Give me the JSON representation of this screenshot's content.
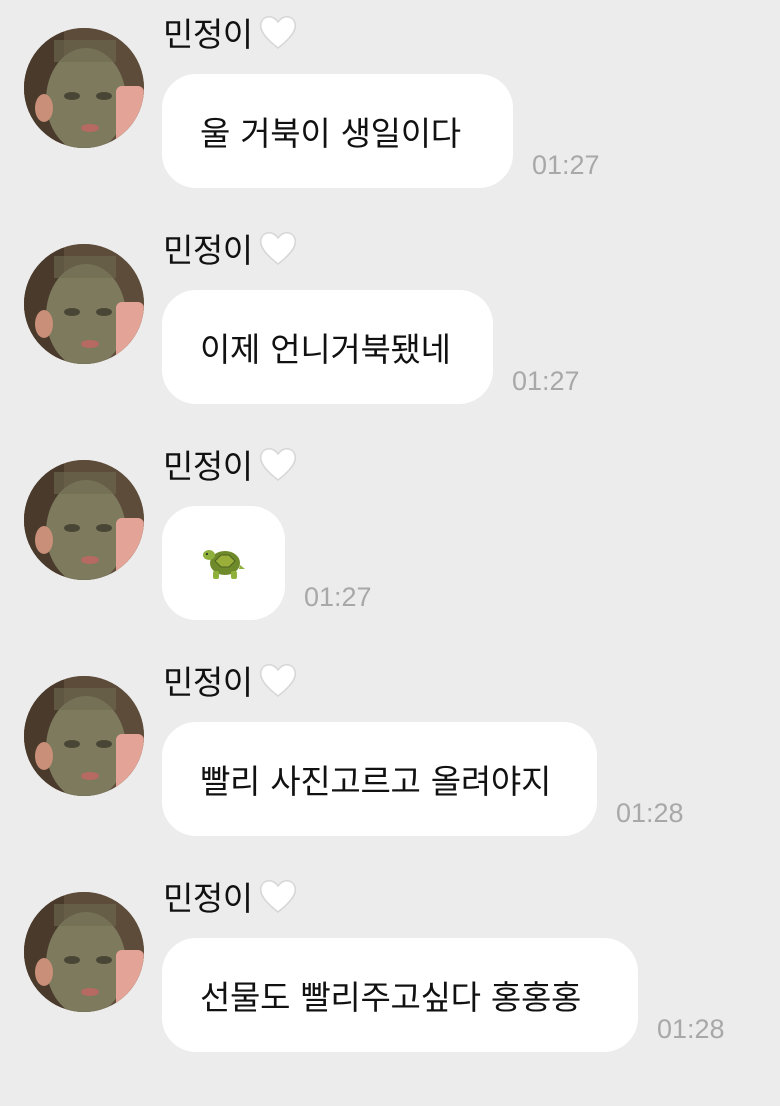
{
  "colors": {
    "background": "#ececec",
    "bubble": "#ffffff",
    "text": "#111111",
    "timestamp": "#a8a8a8"
  },
  "messages": [
    {
      "sender": "민정이",
      "sender_badge": "white-heart-icon",
      "text": "울 거북이 생일이다",
      "time": "01:27"
    },
    {
      "sender": "민정이",
      "sender_badge": "white-heart-icon",
      "text": "이제 언니거북됐네",
      "time": "01:27"
    },
    {
      "sender": "민정이",
      "sender_badge": "white-heart-icon",
      "text": "",
      "emoji": "turtle-icon",
      "time": "01:27"
    },
    {
      "sender": "민정이",
      "sender_badge": "white-heart-icon",
      "text": "빨리 사진고르고 올려야지",
      "time": "01:28"
    },
    {
      "sender": "민정이",
      "sender_badge": "white-heart-icon",
      "text": "선물도 빨리주고싶다 홍홍홍",
      "time": "01:28"
    }
  ]
}
